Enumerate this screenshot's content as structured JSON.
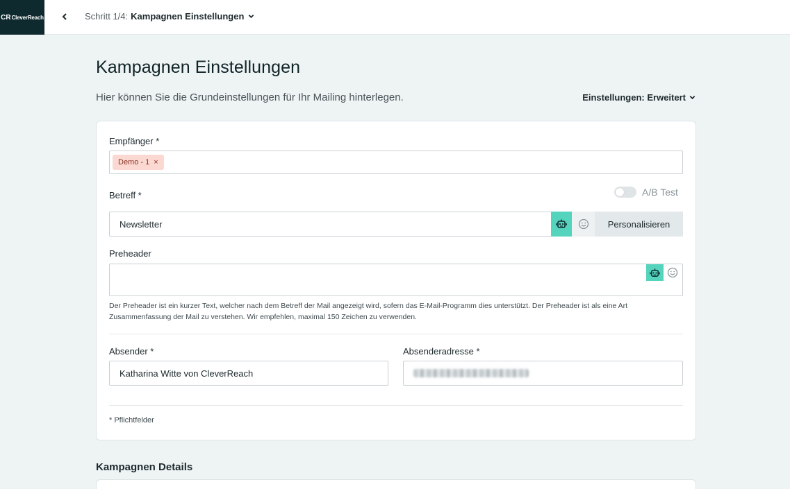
{
  "logo": {
    "mark": "CR",
    "text": "CleverReach"
  },
  "header": {
    "step_prefix": "Schritt 1/4:",
    "step_title": "Kampagnen Einstellungen"
  },
  "page": {
    "title": "Kampagnen Einstellungen",
    "subtitle": "Hier können Sie die Grundeinstellungen für Ihr Mailing hinterlegen.",
    "settings_mode": "Einstellungen: Erweitert"
  },
  "form": {
    "recipients_label": "Empfänger *",
    "recipient_tag": "Demo  - 1",
    "recipient_tag_remove": "×",
    "subject_label": "Betreff *",
    "ab_test_label": "A/B Test",
    "subject_value": "Newsletter",
    "personalize_label": "Personalisieren",
    "preheader_label": "Preheader",
    "preheader_value": "",
    "preheader_help": "Der Preheader ist ein kurzer Text, welcher nach dem Betreff der Mail angezeigt wird, sofern das E-Mail-Programm dies unterstützt. Der Preheader ist als eine Art Zusammenfassung der Mail zu verstehen. Wir empfehlen, maximal 150 Zeichen zu verwenden.",
    "sender_label": "Absender *",
    "sender_value": "Katharina Witte von CleverReach",
    "sender_address_label": "Absenderadresse *",
    "required_note": "* Pflichtfelder"
  },
  "details": {
    "title": "Kampagnen Details"
  },
  "colors": {
    "accent": "#55d4bd",
    "logo_bg": "#0e2a2e",
    "tag_bg": "#fbd9d2"
  },
  "icons": [
    "chevron-left-icon",
    "chevron-down-icon",
    "robot-icon",
    "smiley-icon"
  ]
}
